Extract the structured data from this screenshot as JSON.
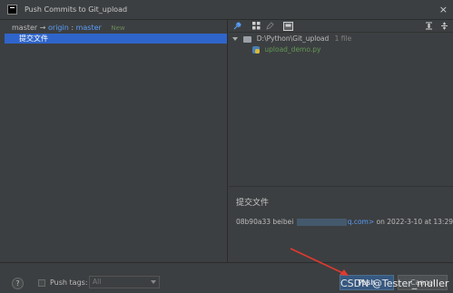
{
  "window": {
    "title": "Push Commits to Git_upload",
    "close_glyph": "×"
  },
  "left": {
    "branch_local": "master",
    "arrow": "→",
    "remote": "origin",
    "separator": ":",
    "branch_remote": "master",
    "new_badge": "New",
    "commits": [
      {
        "message": "提交文件"
      }
    ]
  },
  "right": {
    "toolbar_icons": [
      "pin-icon",
      "grid-icon",
      "edit-icon",
      "preview-icon",
      "expand-all-icon",
      "collapse-all-icon"
    ],
    "tree": {
      "folder_path": "D:\\Python\\Git_upload",
      "folder_count": "1 file",
      "file_name": "upload_demo.py"
    },
    "details": {
      "title": "提交文件",
      "hash": "08b90a33",
      "author": "beibei",
      "email_tail": "q.com>",
      "date_text": "on 2022-3-10 at 13:29"
    }
  },
  "bottom": {
    "help": "?",
    "push_tags_label": "Push tags:",
    "tags_select_value": "All",
    "push_label": "Push",
    "cancel_label": "Cancel",
    "watermark": "CSDN @Tester_muller"
  },
  "colors": {
    "selection": "#2f65ca",
    "link": "#589df6",
    "file_green": "#629755",
    "new_badge": "#6a8759"
  }
}
